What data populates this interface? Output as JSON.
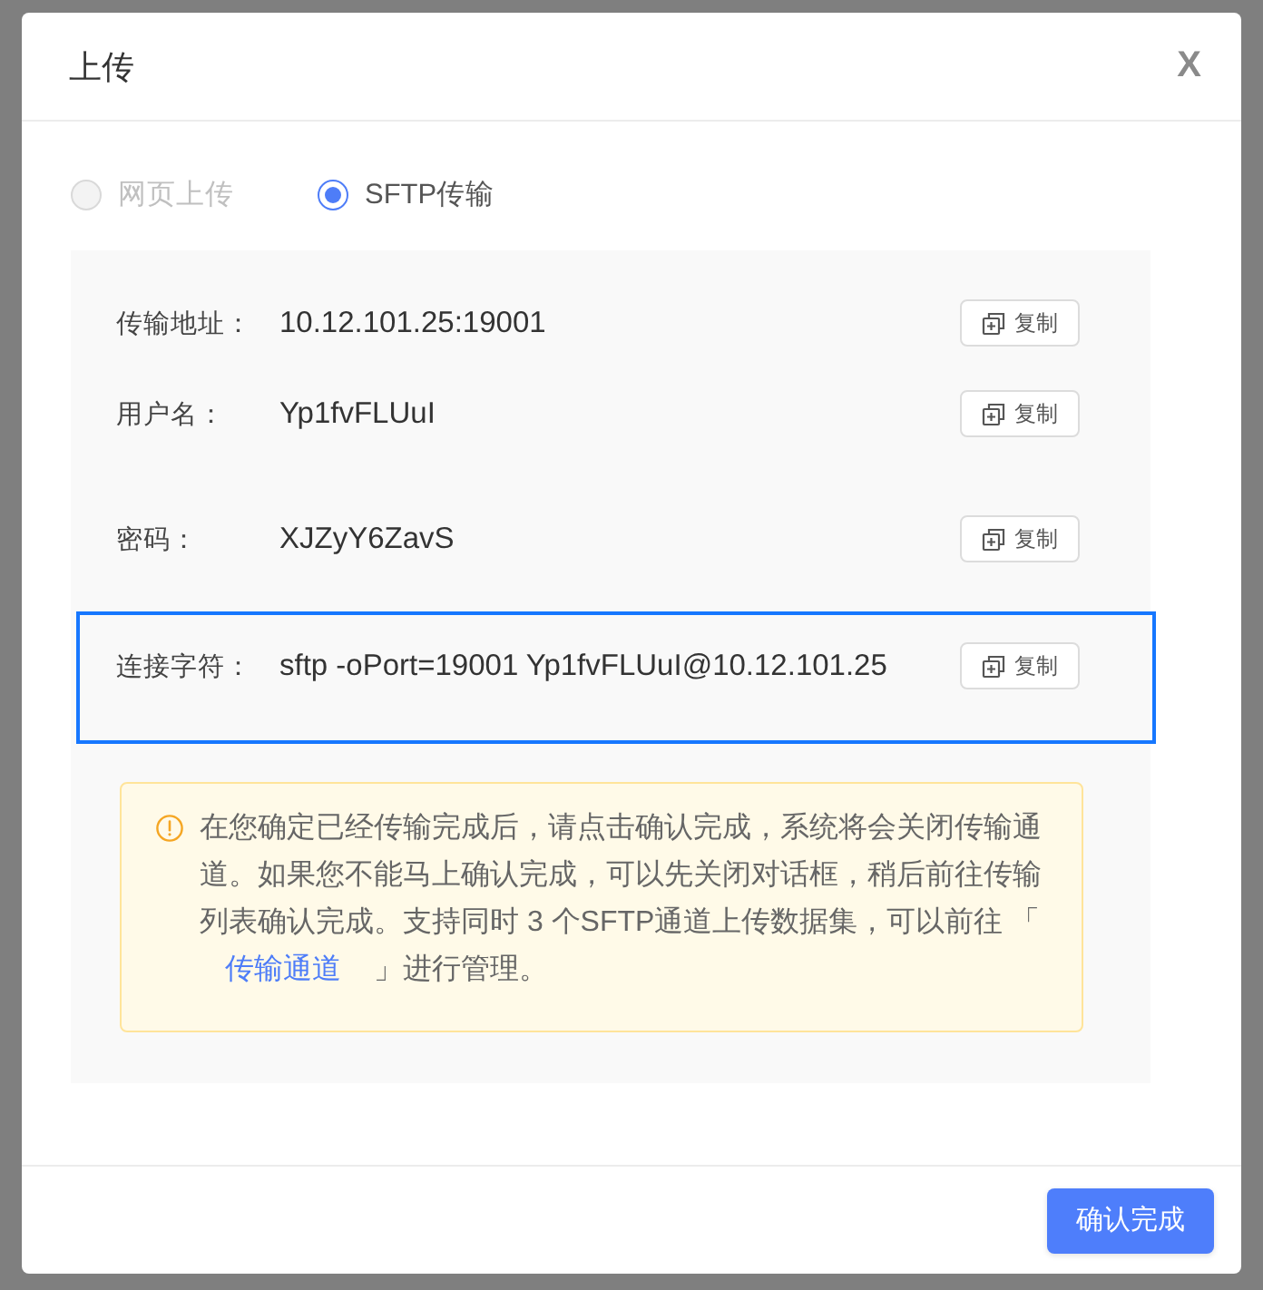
{
  "dialog": {
    "title": "上传",
    "close": "X"
  },
  "upload_methods": [
    {
      "label": "网页上传",
      "selected": false,
      "disabled": true
    },
    {
      "label": "SFTP传输",
      "selected": true,
      "disabled": false
    }
  ],
  "credentials": [
    {
      "label": "传输地址：",
      "value": "10.12.101.25:19001",
      "copy": "复制",
      "highlighted": false
    },
    {
      "label": "用户名：",
      "value": "Yp1fvFLUuI",
      "copy": "复制",
      "highlighted": false
    },
    {
      "label": "密码：",
      "value": "XJZyY6ZavS",
      "copy": "复制",
      "highlighted": false
    },
    {
      "label": "连接字符：",
      "value": "sftp -oPort=19001 Yp1fvFLUuI@10.12.101.25",
      "copy": "复制",
      "highlighted": true
    }
  ],
  "notice": {
    "text_before": "在您确定已经传输完成后，请点击确认完成，系统将会关闭传输通道。如果您不能马上确认完成，可以先关闭对话框，稍后前往传输列表确认完成。支持同时 3 个SFTP通道上传数据集，可以前往 「",
    "link": "传输通道",
    "text_after": "」进行管理。"
  },
  "footer": {
    "confirm": "确认完成"
  }
}
